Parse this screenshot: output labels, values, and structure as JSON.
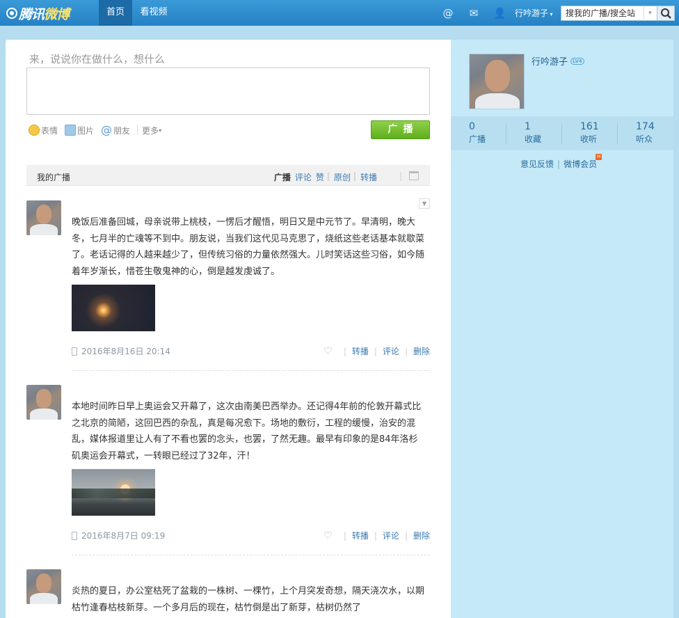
{
  "brand": {
    "name_a": "腾讯",
    "name_b": "微博"
  },
  "nav": {
    "tabs": [
      "首页",
      "看视频"
    ]
  },
  "user": {
    "name": "行吟游子",
    "level": "LV4"
  },
  "search": {
    "placeholder": "搜我的广播/搜全站"
  },
  "compose": {
    "placeholder": "来，说说你在做什么，想什么",
    "tools": [
      "表情",
      "图片",
      "朋友",
      "更多"
    ],
    "submit": "广播"
  },
  "feed": {
    "title": "我的广播",
    "filters": [
      "广播",
      "评论",
      "赞",
      "原创",
      "转播"
    ],
    "actions": {
      "repost": "转播",
      "comment": "评论",
      "delete": "删除"
    },
    "posts": [
      {
        "text": "晚饭后准备回城，母亲说带上桃枝，一愣后才醒悟，明日又是中元节了。早清明，晚大冬，七月半的亡魂等不到中。朋友说，当我们这代见马克思了，烧纸这些老话基本就歇菜了。老话记得的人越来越少了，但传统习俗的力量依然强大。儿时笑话这些习俗，如今随着年岁渐长，惜苍生敬鬼神的心，倒是越发虔诚了。",
        "date": "2016年8月16日 20:14"
      },
      {
        "text": "本地时间昨日早上奥运会又开幕了，这次由南美巴西举办。还记得4年前的伦敦开幕式比之北京的简陋，这回巴西的杂乱，真是每况愈下。场地的敷衍，工程的缓慢，治安的混乱，媒体报道里让人有了不看也罢的念头，也罢，了然无趣。最早有印象的是84年洛杉矶奥运会开幕式，一转眼已经过了32年，汗！",
        "date": "2016年8月7日 09:19"
      },
      {
        "text": "炎热的夏日，办公室枯死了盆栽的一株树、一棵竹，上个月突发奇想，隔天浇次水，以期枯竹逢春枯枝新芽。一个多月后的现在，枯竹倒是出了新芽，枯树仍然了"
      }
    ]
  },
  "stats": [
    {
      "num": "0",
      "label": "广播"
    },
    {
      "num": "1",
      "label": "收藏"
    },
    {
      "num": "161",
      "label": "收听"
    },
    {
      "num": "174",
      "label": "听众"
    }
  ],
  "side_links": {
    "feedback": "意见反馈",
    "vip": "微博会员",
    "hot": "H"
  }
}
